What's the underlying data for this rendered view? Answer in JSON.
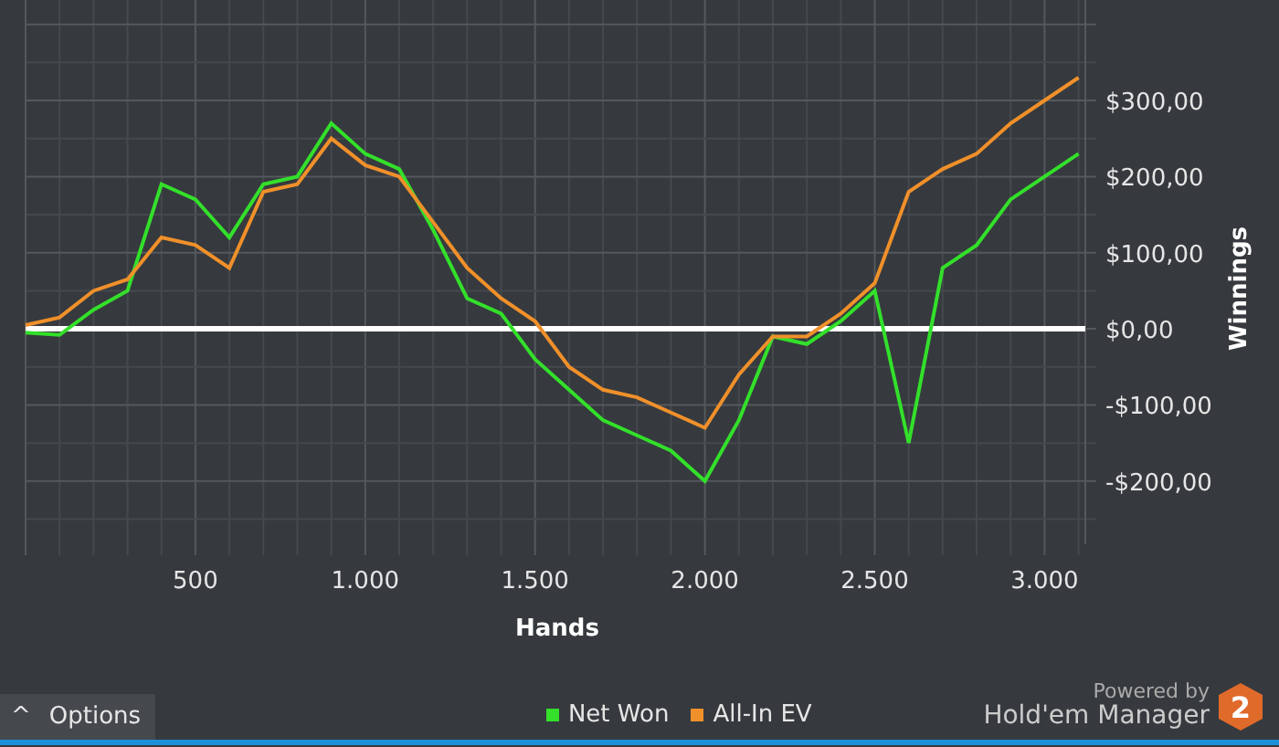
{
  "chart_data": {
    "type": "line",
    "xlabel": "Hands",
    "ylabel": "Winnings",
    "x": [
      0,
      100,
      200,
      300,
      400,
      500,
      600,
      700,
      800,
      900,
      1000,
      1100,
      1200,
      1300,
      1400,
      1500,
      1600,
      1700,
      1800,
      1900,
      2000,
      2100,
      2200,
      2300,
      2400,
      2500,
      2600,
      2700,
      2800,
      2900,
      3000,
      3100
    ],
    "series": [
      {
        "name": "Net Won",
        "color": "#33e02a",
        "values": [
          -5,
          -8,
          25,
          50,
          190,
          170,
          120,
          190,
          200,
          270,
          230,
          210,
          130,
          40,
          20,
          -40,
          -80,
          -120,
          -140,
          -160,
          -200,
          -120,
          -10,
          -20,
          10,
          50,
          -150,
          80,
          110,
          170,
          200,
          230
        ]
      },
      {
        "name": "All-In EV",
        "color": "#f0902a",
        "values": [
          5,
          15,
          50,
          65,
          120,
          110,
          80,
          180,
          190,
          250,
          215,
          200,
          140,
          80,
          40,
          10,
          -50,
          -80,
          -90,
          -110,
          -130,
          -60,
          -10,
          -10,
          20,
          60,
          180,
          210,
          230,
          270,
          300,
          330
        ]
      }
    ],
    "grid": true,
    "xlim": [
      0,
      3120
    ],
    "ylim": [
      -283,
      432
    ],
    "xticks": [
      {
        "value": 500,
        "label": "500"
      },
      {
        "value": 1000,
        "label": "1.000"
      },
      {
        "value": 1500,
        "label": "1.500"
      },
      {
        "value": 2000,
        "label": "2.000"
      },
      {
        "value": 2500,
        "label": "2.500"
      },
      {
        "value": 3000,
        "label": "3.000"
      }
    ],
    "yticks": [
      {
        "value": 300,
        "label": "$300,00"
      },
      {
        "value": 200,
        "label": "$200,00"
      },
      {
        "value": 100,
        "label": "$100,00"
      },
      {
        "value": 0,
        "label": "$0,00"
      },
      {
        "value": -100,
        "label": "-$100,00"
      },
      {
        "value": -200,
        "label": "-$200,00"
      }
    ]
  },
  "options_button": {
    "label": "Options",
    "icon": "^"
  },
  "branding": {
    "powered_by": "Powered by",
    "product": "Hold'em Manager",
    "badge": "2"
  }
}
